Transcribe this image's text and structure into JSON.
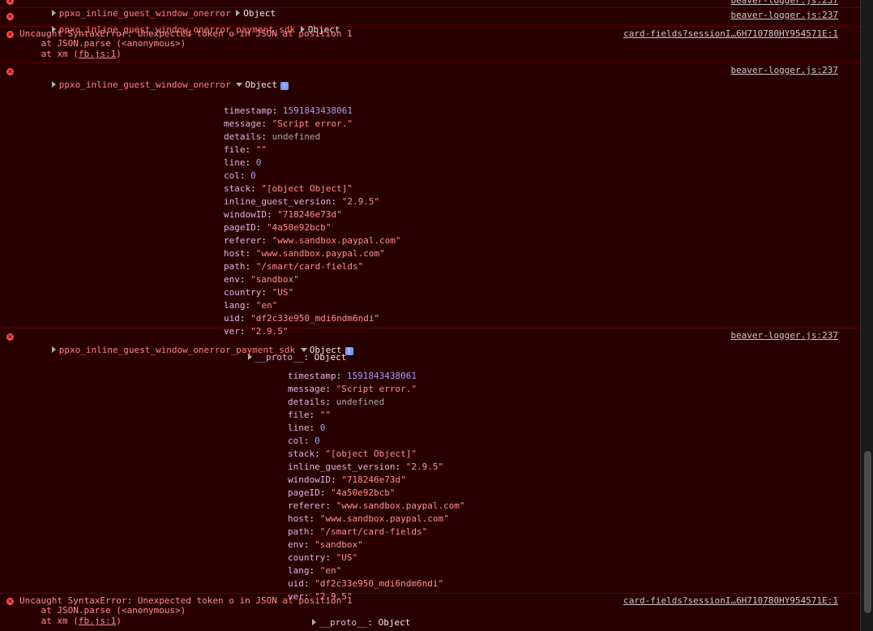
{
  "entries_top": [
    {
      "label": "ppxo_inline_guest_window_onerror",
      "obj": "Object",
      "source": "beaver-logger.js:237"
    },
    {
      "label": "ppxo_inline_guest_window_onerror_payment_sdk",
      "obj": "Object",
      "source": "beaver-logger.js:237"
    }
  ],
  "syntax_error_1": {
    "message": "Uncaught SyntaxError: Unexpected token o in JSON at position 1",
    "stack1": "    at JSON.parse (<anonymous>)",
    "stack2_prefix": "    at xm (",
    "stack2_link": "fb.js:1",
    "stack2_suffix": ")",
    "source": "card-fields?sessionI…6H710780HY954571E:1"
  },
  "expanded_1": {
    "label": "ppxo_inline_guest_window_onerror",
    "obj": "Object",
    "source": "beaver-logger.js:237",
    "props": [
      {
        "k": "timestamp",
        "v": "1591843438061",
        "t": "num"
      },
      {
        "k": "message",
        "v": "\"Script error.\"",
        "t": "str"
      },
      {
        "k": "details",
        "v": "undefined",
        "t": "undef"
      },
      {
        "k": "file",
        "v": "\"\"",
        "t": "str"
      },
      {
        "k": "line",
        "v": "0",
        "t": "num"
      },
      {
        "k": "col",
        "v": "0",
        "t": "num"
      },
      {
        "k": "stack",
        "v": "\"[object Object]\"",
        "t": "str"
      },
      {
        "k": "inline_guest_version",
        "v": "\"2.9.5\"",
        "t": "str"
      },
      {
        "k": "windowID",
        "v": "\"718246e73d\"",
        "t": "str"
      },
      {
        "k": "pageID",
        "v": "\"4a50e92bcb\"",
        "t": "str"
      },
      {
        "k": "referer",
        "v": "\"www.sandbox.paypal.com\"",
        "t": "str"
      },
      {
        "k": "host",
        "v": "\"www.sandbox.paypal.com\"",
        "t": "str"
      },
      {
        "k": "path",
        "v": "\"/smart/card-fields\"",
        "t": "str"
      },
      {
        "k": "env",
        "v": "\"sandbox\"",
        "t": "str"
      },
      {
        "k": "country",
        "v": "\"US\"",
        "t": "str"
      },
      {
        "k": "lang",
        "v": "\"en\"",
        "t": "str"
      },
      {
        "k": "uid",
        "v": "\"df2c33e950_mdi6ndm6ndi\"",
        "t": "str"
      },
      {
        "k": "ver",
        "v": "\"2.9.5\"",
        "t": "str"
      }
    ],
    "proto_label": "__proto__",
    "proto_value": "Object"
  },
  "expanded_2": {
    "label": "ppxo_inline_guest_window_onerror_payment_sdk",
    "obj": "Object",
    "source": "beaver-logger.js:237",
    "props": [
      {
        "k": "timestamp",
        "v": "1591843438061",
        "t": "num"
      },
      {
        "k": "message",
        "v": "\"Script error.\"",
        "t": "str"
      },
      {
        "k": "details",
        "v": "undefined",
        "t": "undef"
      },
      {
        "k": "file",
        "v": "\"\"",
        "t": "str"
      },
      {
        "k": "line",
        "v": "0",
        "t": "num"
      },
      {
        "k": "col",
        "v": "0",
        "t": "num"
      },
      {
        "k": "stack",
        "v": "\"[object Object]\"",
        "t": "str"
      },
      {
        "k": "inline_guest_version",
        "v": "\"2.9.5\"",
        "t": "str"
      },
      {
        "k": "windowID",
        "v": "\"718246e73d\"",
        "t": "str"
      },
      {
        "k": "pageID",
        "v": "\"4a50e92bcb\"",
        "t": "str"
      },
      {
        "k": "referer",
        "v": "\"www.sandbox.paypal.com\"",
        "t": "str"
      },
      {
        "k": "host",
        "v": "\"www.sandbox.paypal.com\"",
        "t": "str"
      },
      {
        "k": "path",
        "v": "\"/smart/card-fields\"",
        "t": "str"
      },
      {
        "k": "env",
        "v": "\"sandbox\"",
        "t": "str"
      },
      {
        "k": "country",
        "v": "\"US\"",
        "t": "str"
      },
      {
        "k": "lang",
        "v": "\"en\"",
        "t": "str"
      },
      {
        "k": "uid",
        "v": "\"df2c33e950_mdi6ndm6ndi\"",
        "t": "str"
      },
      {
        "k": "ver",
        "v": "\"2.9.5\"",
        "t": "str"
      }
    ],
    "proto_label": "__proto__",
    "proto_value": "Object"
  },
  "syntax_error_2": {
    "message": "Uncaught SyntaxError: Unexpected token o in JSON at position 1",
    "stack1": "    at JSON.parse (<anonymous>)",
    "stack2_prefix": "    at xm (",
    "stack2_link": "fb.js:1",
    "stack2_suffix": ")",
    "source": "card-fields?sessionI…6H710780HY954571E:1"
  },
  "icons": {
    "error": "error-circle-icon",
    "expand": "triangle-right-icon",
    "collapse": "triangle-down-icon",
    "info": "info-icon"
  },
  "colors": {
    "background": "#290000",
    "error": "#ff4d4d",
    "string": "#ff8f8f",
    "number": "#9d9dff",
    "key": "#e7b0e7"
  }
}
